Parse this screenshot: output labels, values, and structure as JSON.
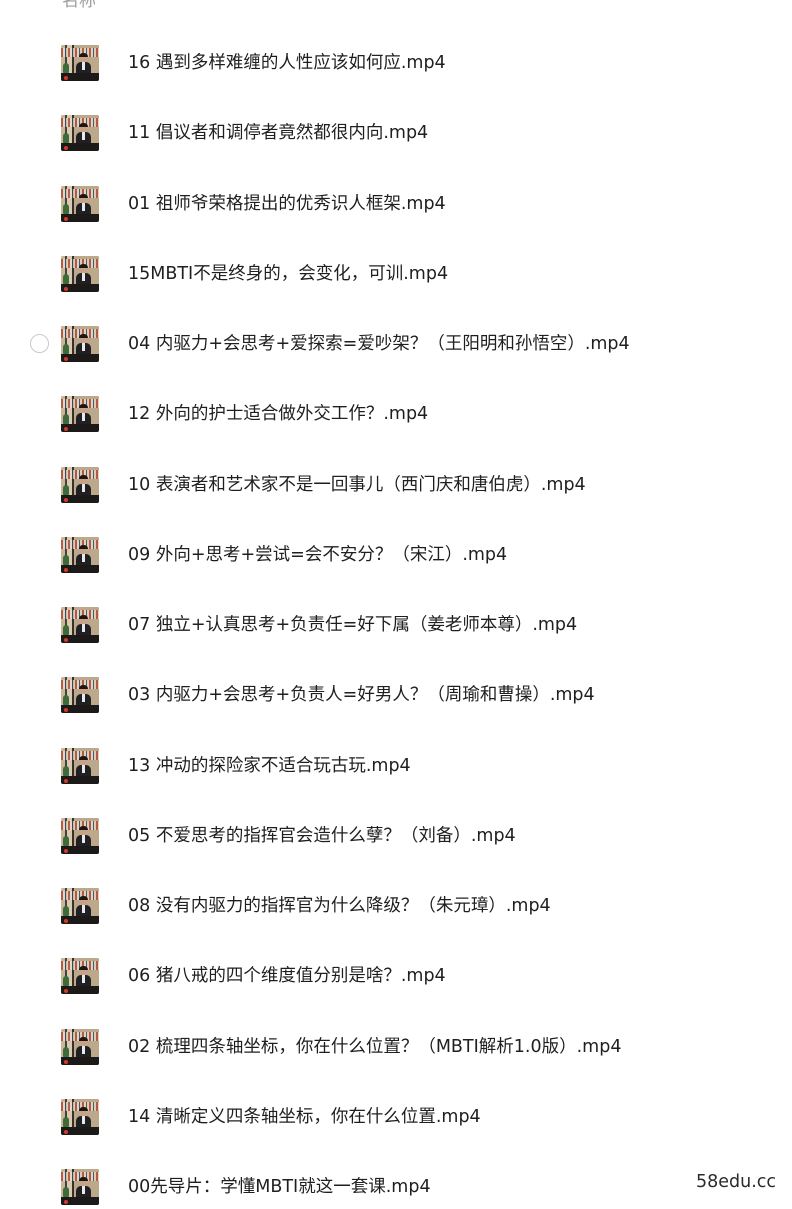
{
  "list": {
    "column_header": "名称",
    "files": [
      {
        "name": "16 遇到多样难缠的人性应该如何应.mp4",
        "thumb_icon": "video-thumbnail-icon"
      },
      {
        "name": "11 倡议者和调停者竟然都很内向.mp4",
        "thumb_icon": "video-thumbnail-icon"
      },
      {
        "name": "01 祖师爷荣格提出的优秀识人框架.mp4",
        "thumb_icon": "video-thumbnail-icon"
      },
      {
        "name": "15MBTI不是终身的，会变化，可训.mp4",
        "thumb_icon": "video-thumbnail-icon"
      },
      {
        "name": "04 内驱力+会思考+爱探索=爱吵架？（王阳明和孙悟空）.mp4",
        "thumb_icon": "video-thumbnail-icon",
        "hover": true
      },
      {
        "name": "12 外向的护士适合做外交工作？.mp4",
        "thumb_icon": "video-thumbnail-icon"
      },
      {
        "name": "10 表演者和艺术家不是一回事儿（西门庆和唐伯虎）.mp4",
        "thumb_icon": "video-thumbnail-icon"
      },
      {
        "name": "09 外向+思考+尝试=会不安分？（宋江）.mp4",
        "thumb_icon": "video-thumbnail-icon"
      },
      {
        "name": "07 独立+认真思考+负责任=好下属（姜老师本尊）.mp4",
        "thumb_icon": "video-thumbnail-icon"
      },
      {
        "name": "03 内驱力+会思考+负责人=好男人？（周瑜和曹操）.mp4",
        "thumb_icon": "video-thumbnail-icon"
      },
      {
        "name": "13 冲动的探险家不适合玩古玩.mp4",
        "thumb_icon": "video-thumbnail-icon"
      },
      {
        "name": "05 不爱思考的指挥官会造什么孽？（刘备）.mp4",
        "thumb_icon": "video-thumbnail-icon"
      },
      {
        "name": "08 没有内驱力的指挥官为什么降级？（朱元璋）.mp4",
        "thumb_icon": "video-thumbnail-icon"
      },
      {
        "name": "06 猪八戒的四个维度值分别是啥？.mp4",
        "thumb_icon": "video-thumbnail-icon"
      },
      {
        "name": "02 梳理四条轴坐标，你在什么位置？（MBTI解析1.0版）.mp4",
        "thumb_icon": "video-thumbnail-icon"
      },
      {
        "name": "14 清晰定义四条轴坐标，你在什么位置.mp4",
        "thumb_icon": "video-thumbnail-icon"
      },
      {
        "name": "00先导片：学懂MBTI就这一套课.mp4",
        "thumb_icon": "video-thumbnail-icon"
      }
    ]
  },
  "watermark": "58edu.cc"
}
